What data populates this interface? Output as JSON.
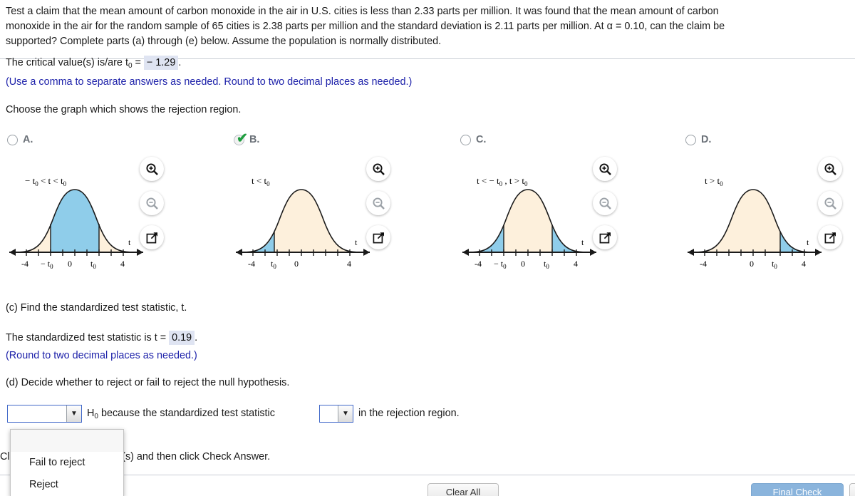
{
  "problem": {
    "line1": "Test a claim that the mean amount of carbon monoxide in the air in U.S. cities is less than 2.33 parts per million. It was found that the mean amount of carbon",
    "line2": "monoxide in the air for the random sample of 65 cities is 2.38 parts per million and the standard deviation is 2.11 parts per million. At α = 0.10, can the claim be",
    "line3": "supported? Complete parts (a) through (e) below. Assume the population is normally distributed."
  },
  "critical_value": {
    "prefix": "The critical value(s) is/are t",
    "subscript": "0",
    "equals": "=",
    "value": "− 1.29",
    "period": ".",
    "hint": "(Use a comma to separate answers as needed. Round to two decimal places as needed.)"
  },
  "choose_prompt": "Choose the graph which shows the rejection region.",
  "choices": [
    {
      "letter": "A.",
      "selected": false,
      "caption": "− t₀ < t < t₀",
      "region": "center",
      "tick_labels": [
        "-4",
        "− t₀",
        "0",
        "t₀",
        "4"
      ],
      "axis_label": "t"
    },
    {
      "letter": "B.",
      "selected": true,
      "caption": "t < t₀",
      "region": "left-tail",
      "tick_labels": [
        "-4",
        "t₀",
        "0",
        "4"
      ],
      "axis_label": "t"
    },
    {
      "letter": "C.",
      "selected": false,
      "caption": "t < − t₀ , t > t₀",
      "region": "two-tail",
      "tick_labels": [
        "-4",
        "− t₀",
        "0",
        "t₀",
        "4"
      ],
      "axis_label": "t"
    },
    {
      "letter": "D.",
      "selected": false,
      "caption": "t > t₀",
      "region": "right-tail",
      "tick_labels": [
        "-4",
        "0",
        "t₀",
        "4"
      ],
      "axis_label": "t"
    }
  ],
  "part_c": {
    "prompt": "(c) Find the standardized test statistic, t.",
    "statement_prefix": "The standardized test statistic is t =",
    "value": "0.19",
    "period": ".",
    "hint": "(Round to two decimal places as needed.)"
  },
  "part_d": {
    "prompt": "(d) Decide whether to reject or fail to reject the null hypothesis.",
    "select1_value": "",
    "middle_prefix": "H",
    "middle_subscript": "0",
    "middle_text": "because the standardized test statistic",
    "select2_value": "",
    "suffix": "in the rejection region.",
    "options": [
      "",
      "Fail to reject",
      "Reject"
    ]
  },
  "footer_note": "Click to select your answer(s) and then click Check Answer.",
  "buttons": {
    "clear_all": "Clear All",
    "final_check": "Final Check"
  },
  "icons": {
    "zoom_in": "zoom-in-icon",
    "zoom_out": "zoom-out-icon",
    "pop_out": "pop-out-icon",
    "dropdown_arrow": "▼"
  },
  "colors": {
    "shaded_region": "#8fcdea",
    "curve_fill": "#fdf0dc",
    "hint_text": "#1e22aa",
    "answer_bg": "#dfe4f2",
    "select_border": "#4169c9",
    "check_mark": "#1f9d3f"
  }
}
